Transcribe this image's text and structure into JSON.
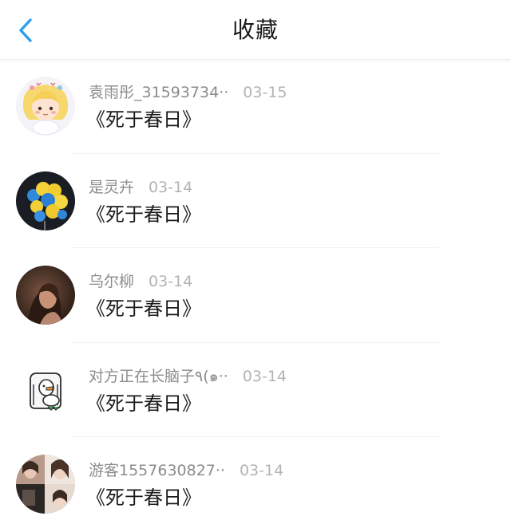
{
  "header": {
    "title": "收藏",
    "back_icon": "chevron-left-icon",
    "accent_color": "#2e9ff0"
  },
  "items": [
    {
      "username": "袁雨彤_31593734··",
      "date": "03-15",
      "book": "《死于春日》",
      "avatar": "cartoon-girl-avatar"
    },
    {
      "username": "是灵卉",
      "date": "03-14",
      "book": "《死于春日》",
      "avatar": "balloons-avatar"
    },
    {
      "username": "乌尔柳",
      "date": "03-14",
      "book": "《死于春日》",
      "avatar": "portrait-photo-avatar"
    },
    {
      "username": "对方正在长脑子٩(๑··",
      "date": "03-14",
      "book": "《死于春日》",
      "avatar": "cartoon-duck-avatar"
    },
    {
      "username": "游客1557630827··",
      "date": "03-14",
      "book": "《死于春日》",
      "avatar": "photo-collage-avatar"
    }
  ]
}
